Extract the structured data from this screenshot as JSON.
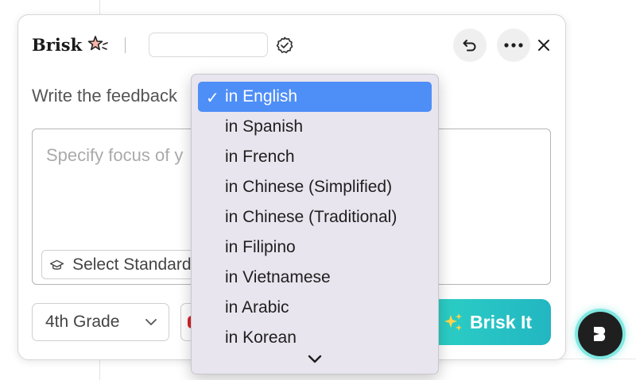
{
  "app": {
    "brand": "Brisk",
    "name_field_value": "",
    "prompt": "Write the feedback"
  },
  "focus": {
    "placeholder": "Specify focus of y",
    "standards_label": "Select Standards"
  },
  "controls": {
    "grade": "4th Grade",
    "submit_label": "Brisk It"
  },
  "language_menu": {
    "selected_index": 0,
    "options": [
      "in English",
      "in Spanish",
      "in French",
      "in Chinese (Simplified)",
      "in Chinese (Traditional)",
      "in Filipino",
      "in Vietnamese",
      "in Arabic",
      "in Korean"
    ]
  },
  "icons": {
    "brand": "sparkle-star-icon",
    "verify": "badge-check-icon",
    "undo": "undo-icon",
    "more": "ellipsis-icon",
    "close": "close-icon",
    "standards": "graduation-cap-icon",
    "select": "chevron-down-icon",
    "submit": "sparkles-icon",
    "fab": "brisk-logo-icon",
    "scroll": "chevron-down-icon"
  },
  "colors": {
    "accent": "#2fd6c6",
    "selection": "#4e8ef7",
    "menu_bg": "#e8e5ee"
  }
}
